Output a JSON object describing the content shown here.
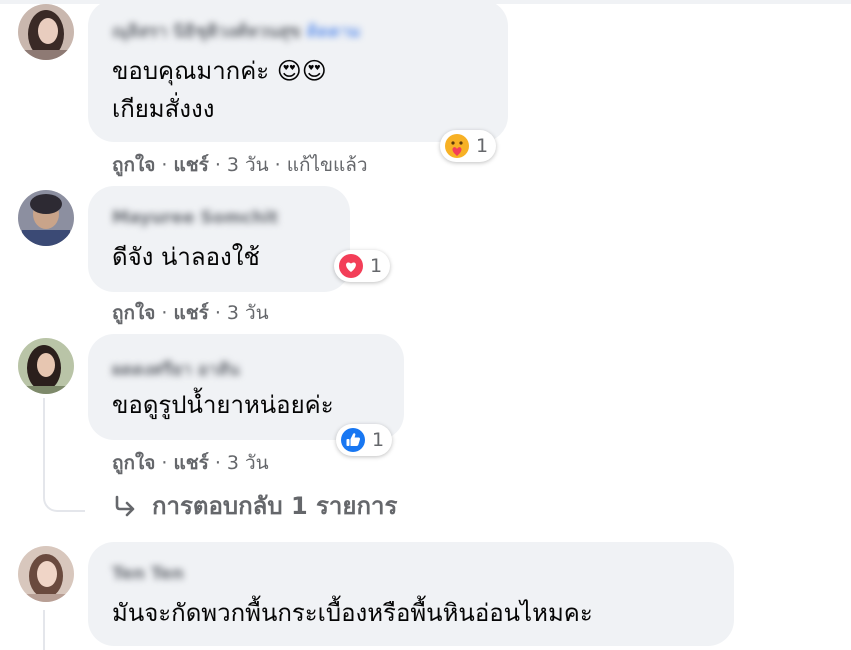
{
  "comments": [
    {
      "author": "ณุลิสรา นิธิชุติวงศ์หวนสุข",
      "author_tag": "ติดตาม",
      "lines": [
        "ขอบคุณมากค่ะ 😍😍",
        "เกียมสั่งงง"
      ],
      "reaction": {
        "icon": "care-emoji-icon",
        "count": "1"
      },
      "actions": {
        "like": "ถูกใจ",
        "reply": "แชร์",
        "time": "3 วัน",
        "edited": "แก้ไขแล้ว"
      }
    },
    {
      "author": "Mayuree Somchit",
      "lines": [
        "ดีจัง น่าลองใช้"
      ],
      "reaction": {
        "icon": "love-heart-icon",
        "count": "1"
      },
      "actions": {
        "like": "ถูกใจ",
        "reply": "แชร์",
        "time": "3 วัน"
      }
    },
    {
      "author": "ผดดงศรียา อาสัน",
      "lines": [
        "ขอดูรูปน้ำยาหน่อยค่ะ"
      ],
      "reaction": {
        "icon": "like-thumb-icon",
        "count": "1"
      },
      "actions": {
        "like": "ถูกใจ",
        "reply": "แชร์",
        "time": "3 วัน"
      },
      "replies_link": "การตอบกลับ 1 รายการ"
    },
    {
      "author": "Ten Ten",
      "lines": [
        "มันจะกัดพวกพื้นกระเบื้องหรือพื้นหินอ่อนไหมคะ"
      ]
    }
  ],
  "colors": {
    "bubble": "#f0f2f5",
    "meta_text": "#65676b",
    "like_blue": "#1877f2",
    "love_red": "#f33e58",
    "emoji_yellow": "#f7b125"
  }
}
